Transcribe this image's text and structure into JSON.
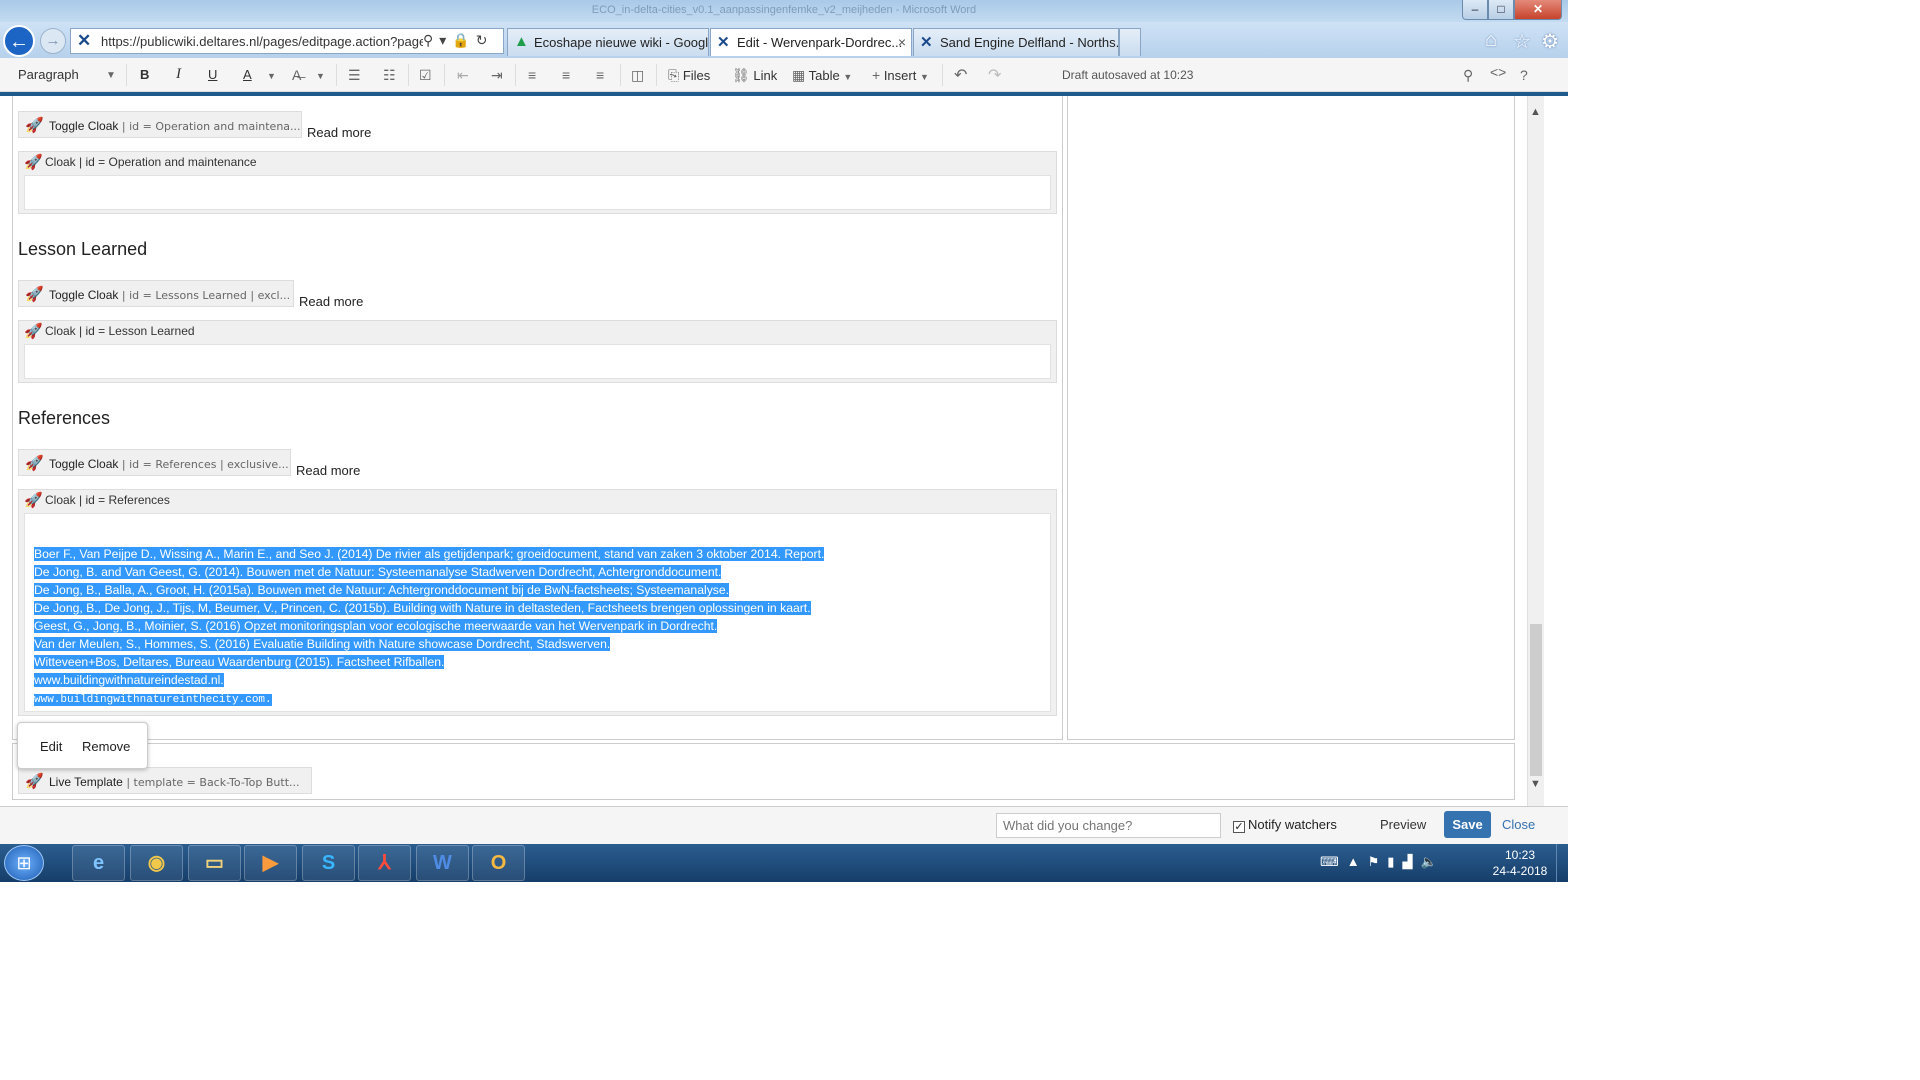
{
  "window": {
    "title": "ECO_in-delta-cities_v0.1_aanpassingenfemke_v2_meijheden - Microsoft Word",
    "min_label": "–",
    "max_label": "□",
    "close_label": "✕"
  },
  "browser": {
    "url": "https://publicwiki.deltares.nl/pages/editpage.action?pageI",
    "tabs": [
      {
        "label": "Ecoshape nieuwe wiki - Googl..."
      },
      {
        "label": "Edit - Wervenpark-Dordrec..."
      },
      {
        "label": "Sand Engine Delfland - Norths..."
      }
    ]
  },
  "toolbar": {
    "paragraph": "Paragraph",
    "files": "Files",
    "link": "Link",
    "table": "Table",
    "insert": "Insert",
    "autosave": "Draft autosaved at 10:23"
  },
  "content": {
    "toggle1": {
      "name": "Toggle Cloak",
      "params": " | id = Operation and maintena..."
    },
    "readmore": "Read more",
    "cloak1": {
      "name": "Cloak",
      "params": " | id = Operation and maintenance"
    },
    "heading_lessons": "Lesson Learned",
    "toggle2": {
      "name": "Toggle Cloak",
      "params": " | id = Lessons Learned | excl..."
    },
    "cloak2": {
      "name": "Cloak",
      "params": " | id = Lesson Learned"
    },
    "heading_refs": "References",
    "toggle3": {
      "name": "Toggle Cloak",
      "params": " | id = References | exclusive..."
    },
    "cloak3": {
      "name": "Cloak",
      "params": " | id = References"
    },
    "references": [
      "Boer F., Van Peijpe D., Wissing A., Marin E., and Seo J. (2014) De rivier als getijdenpark; groeidocument, stand van zaken 3 oktober 2014. Report.",
      "De Jong, B. and Van Geest, G. (2014). Bouwen met de Natuur: Systeemanalyse Stadwerven Dordrecht, Achtergronddocument.",
      "De Jong, B., Balla, A., Groot, H. (2015a). Bouwen met de Natuur: Achtergronddocument bij de BwN-factsheets; Systeemanalyse.",
      "De Jong, B., De Jong, J., Tijs, M, Beumer, V., Princen, C. (2015b). Building with Nature in deltasteden, Factsheets brengen oplossingen in kaart.",
      "Geest, G., Jong, B., Moinier, S. (2016) Opzet monitoringsplan voor ecologische meerwaarde van het Wervenpark in Dordrecht.",
      "Van der Meulen, S., Hommes, S. (2016) Evaluatie Building with Nature showcase Dordrecht, Stadswerven.",
      "Witteveen+Bos, Deltares, Bureau Waardenburg (2015). Factsheet Rifballen.",
      "www.buildingwithnatureindestad.nl.",
      "www.buildingwithnatureinthecity.com."
    ],
    "popup": {
      "edit": "Edit",
      "remove": "Remove"
    },
    "live_template": {
      "name": "Live Template",
      "params": " | template = Back-To-Top Butt..."
    }
  },
  "savebar": {
    "change_placeholder": "What did you change?",
    "notify": "Notify watchers",
    "preview": "Preview",
    "save": "Save",
    "close": "Close"
  },
  "taskbar": {
    "time": "10:23",
    "date": "24-4-2018"
  }
}
